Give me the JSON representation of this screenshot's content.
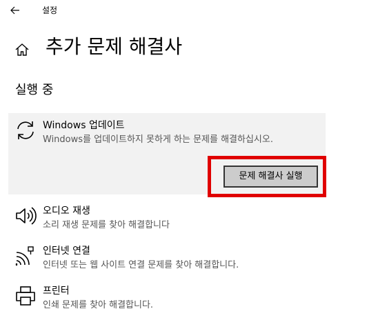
{
  "window": {
    "title": "설정",
    "back_icon": "back-arrow-icon"
  },
  "header": {
    "home_icon": "home-icon",
    "title": "추가 문제 해결사"
  },
  "section": {
    "title": "실행 중"
  },
  "items": [
    {
      "icon": "refresh-icon",
      "title": "Windows 업데이트",
      "description": "Windows를 업데이트하지 못하게 하는 문제를 해결하십시오.",
      "selected": true
    },
    {
      "icon": "speaker-icon",
      "title": "오디오 재생",
      "description": "소리 재생 문제를 찾아 해결합니다"
    },
    {
      "icon": "network-icon",
      "title": "인터넷 연결",
      "description": "인터넷 또는 웹 사이트 연결 문제를 찾아 해결합니다."
    },
    {
      "icon": "printer-icon",
      "title": "프린터",
      "description": "인쇄 문제를 찾아 해결합니다."
    }
  ],
  "run_button": {
    "label": "문제 해결사 실행"
  },
  "colors": {
    "highlight": "#e00000",
    "panel": "#f2f2f2",
    "button_bg": "#cccccc",
    "description_text": "#555555"
  }
}
